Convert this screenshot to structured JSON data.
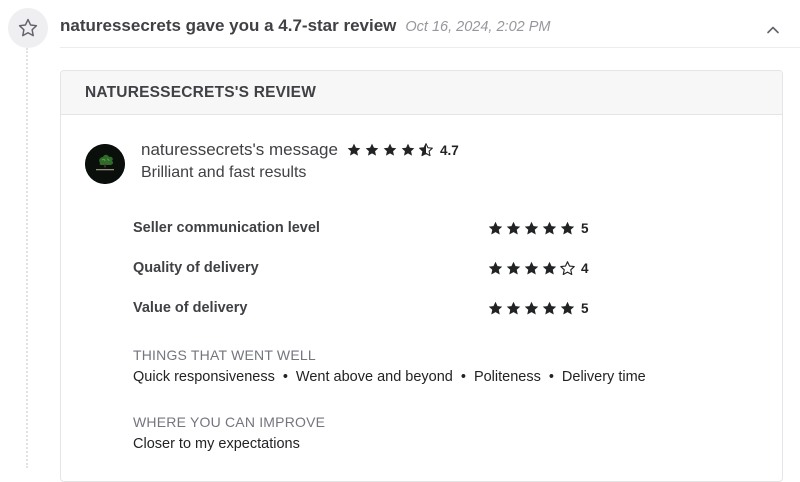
{
  "notification": {
    "title": "naturessecrets gave you a 4.7-star review",
    "date": "Oct 16, 2024, 2:02 PM",
    "icon": "star-outline-icon",
    "toggle_icon": "chevron-up-icon"
  },
  "review": {
    "card_title": "NATURESSECRETS'S REVIEW",
    "avatar": "naturessecrets-avatar",
    "message_title": "naturessecrets's message",
    "overall_rating": 4.7,
    "overall_rating_label": "4.7",
    "message": "Brilliant and fast results",
    "criteria": [
      {
        "label": "Seller communication level",
        "rating": 5,
        "rating_label": "5"
      },
      {
        "label": "Quality of delivery",
        "rating": 4,
        "rating_label": "4"
      },
      {
        "label": "Value of delivery",
        "rating": 5,
        "rating_label": "5"
      }
    ],
    "went_well": {
      "heading": "THINGS THAT WENT WELL",
      "items": [
        "Quick responsiveness",
        "Went above and beyond",
        "Politeness",
        "Delivery time"
      ]
    },
    "improve": {
      "heading": "WHERE YOU CAN IMPROVE",
      "text": "Closer to my expectations"
    }
  },
  "colors": {
    "star": "#222325",
    "text": "#404145",
    "muted": "#74767e"
  }
}
